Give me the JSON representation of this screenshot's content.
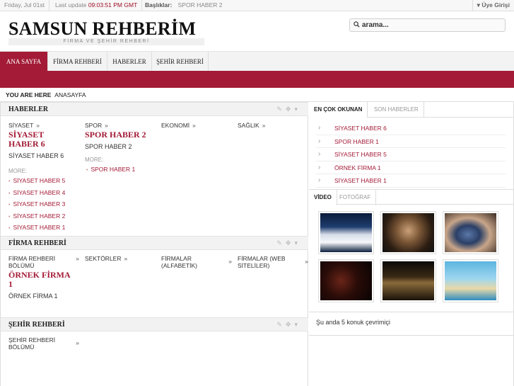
{
  "topbar": {
    "date": "Friday, Jul 01st",
    "last_update_label": "Last update",
    "last_update_time": "09:03:51 PM GMT",
    "headlines_label": "Başlıklar:",
    "headline": "SPOR HABER 2",
    "member_login": "Üye Girişi"
  },
  "header": {
    "logo": "SAMSUN REHBERİM",
    "slogan": "FİRMA VE ŞEHİR REHBERİ",
    "search_placeholder": "arama..."
  },
  "nav": {
    "items": [
      {
        "label": "ANA SAYFA",
        "active": true
      },
      {
        "label": "FİRMA REHBERİ",
        "active": false
      },
      {
        "label": "HABERLER",
        "active": false
      },
      {
        "label": "ŞEHİR REHBERİ",
        "active": false
      }
    ]
  },
  "breadcrumb": {
    "label": "YOU ARE HERE",
    "current": "ANASAYFA"
  },
  "haberler": {
    "title": "HABERLER",
    "columns": [
      {
        "category": "SİYASET",
        "lead": "SİYASET HABER 6",
        "sub": "SİYASET HABER 6",
        "more_label": "MORE:",
        "more": [
          "SİYASET HABER 5",
          "SİYASET HABER 4",
          "SİYASET HABER 3",
          "SİYASET HABER 2",
          "SİYASET HABER 1"
        ]
      },
      {
        "category": "SPOR",
        "lead": "SPOR HABER 2",
        "sub": "SPOR HABER 2",
        "more_label": "MORE:",
        "more": [
          "SPOR HABER 1"
        ]
      },
      {
        "category": "EKONOMİ"
      },
      {
        "category": "SAĞLIK"
      }
    ]
  },
  "firma": {
    "title": "FİRMA REHBERİ",
    "columns": [
      {
        "category": "FİRMA REHBERİ BÖLÜMÜ",
        "lead": "ÖRNEK FİRMA 1",
        "sub": "ÖRNEK FİRMA 1"
      },
      {
        "category": "SEKTÖRLER"
      },
      {
        "category": "FİRMALAR (ALFABETİK)"
      },
      {
        "category": "FİRMALAR (WEB SİTELİLER)"
      }
    ]
  },
  "sehir": {
    "title": "ŞEHİR REHBERİ",
    "columns": [
      {
        "category": "ŞEHİR REHBERİ BÖLÜMÜ"
      }
    ]
  },
  "popular": {
    "tabs": [
      "EN ÇOK OKUNAN",
      "SON HABERLER"
    ],
    "items": [
      "SİYASET HABER 6",
      "SPOR HABER 1",
      "SİYASET HABER 5",
      "ÖRNEK FİRMA 1",
      "SİYASET HABER 1"
    ]
  },
  "media": {
    "tabs": [
      "VİDEO",
      "FOTOĞRAF"
    ]
  },
  "online": "Şu anda 5 konuk çevrimiçi",
  "colors": {
    "accent": "#a31b36"
  }
}
